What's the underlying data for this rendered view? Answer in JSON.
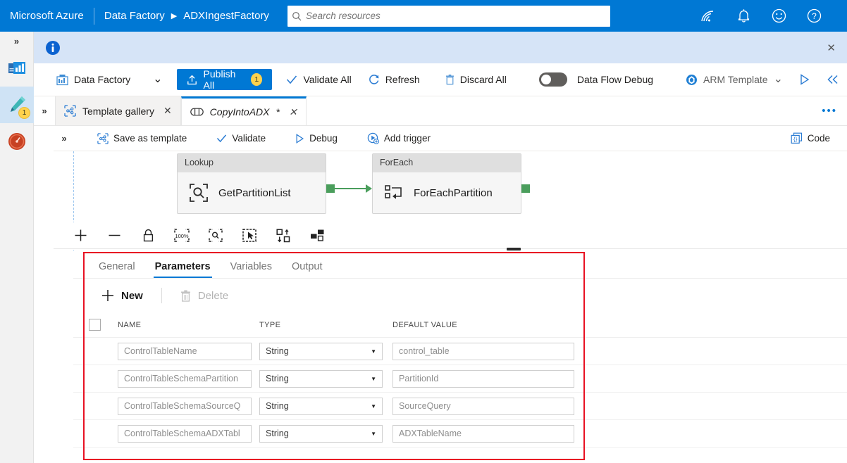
{
  "azure_bar": {
    "brand": "Microsoft Azure",
    "breadcrumb_service": "Data Factory",
    "breadcrumb_chevron": "▶",
    "breadcrumb_resource": "ADXIngestFactory",
    "search_placeholder": "Search resources",
    "search_value": "",
    "icons": [
      "cloud-shell-icon",
      "notifications-bell-icon",
      "feedback-smiley-icon",
      "help-question-icon"
    ],
    "accent_color": "#0078d4"
  },
  "rail": {
    "expand_glyph": "»",
    "items": [
      {
        "name": "home-monitor-icon",
        "badge": ""
      },
      {
        "name": "author-pencil-icon",
        "badge": "1"
      },
      {
        "name": "monitor-gauge-icon",
        "badge": ""
      }
    ]
  },
  "infobar": {
    "icon": "info-circle-icon",
    "message": "",
    "close_label": "✕",
    "background": "#d6e4f7"
  },
  "main_toolbar": {
    "factory_label": "Data Factory",
    "factory_caret": "⌄",
    "publish_label": "Publish All",
    "publish_badge": "1",
    "validate_all_label": "Validate All",
    "refresh_label": "Refresh",
    "discard_all_label": "Discard All",
    "data_flow_debug_label": "Data Flow Debug",
    "data_flow_debug_on": false,
    "arm_template_label": "ARM Template",
    "arm_caret": "⌄",
    "run_icon": "play-triangle-icon",
    "collapse_icon": "double-chevron-left-icon"
  },
  "tabstrip": {
    "expand_glyph": "»",
    "tabs": [
      {
        "label": "Template gallery",
        "icon": "template-gallery-icon",
        "active": false,
        "close": "✕",
        "dirty": ""
      },
      {
        "label": "CopyIntoADX",
        "icon": "pipeline-icon",
        "active": true,
        "close": "✕",
        "dirty": "*"
      }
    ],
    "overflow": "•••"
  },
  "pipeline_toolbar": {
    "expand_glyph": "»",
    "save_as_template_label": "Save as template",
    "validate_label": "Validate",
    "debug_label": "Debug",
    "add_trigger_label": "Add trigger",
    "code_label": "Code"
  },
  "canvas": {
    "activities": [
      {
        "type": "Lookup",
        "name": "GetPartitionList",
        "icon": "lookup-magnifier-icon"
      },
      {
        "type": "ForEach",
        "name": "ForEachPartition",
        "icon": "foreach-loop-icon"
      }
    ],
    "connector_color": "#4a9e5c"
  },
  "zoom_toolbar": {
    "icons": [
      "zoom-in-plus-icon",
      "zoom-out-minus-icon",
      "lock-canvas-icon",
      "zoom-to-100-percent-icon",
      "zoom-to-fit-icon",
      "select-region-icon",
      "auto-align-icon",
      "show-related-icon"
    ],
    "zoom_to_fit_label": "100%"
  },
  "properties_panel": {
    "tabs": [
      {
        "label": "General",
        "active": false
      },
      {
        "label": "Parameters",
        "active": true
      },
      {
        "label": "Variables",
        "active": false
      },
      {
        "label": "Output",
        "active": false
      }
    ],
    "commands": {
      "new_label": "New",
      "new_icon": "plus-icon",
      "delete_label": "Delete",
      "delete_icon": "trash-icon",
      "delete_disabled": true
    },
    "columns": [
      "NAME",
      "TYPE",
      "DEFAULT VALUE"
    ],
    "rows": [
      {
        "name": "ControlTableName",
        "type": "String",
        "default": "control_table"
      },
      {
        "name": "ControlTableSchemaPartition",
        "type": "String",
        "default": "PartitionId"
      },
      {
        "name": "ControlTableSchemaSourceQ",
        "type": "String",
        "default": "SourceQuery"
      },
      {
        "name": "ControlTableSchemaADXTabl",
        "type": "String",
        "default": "ADXTableName"
      }
    ],
    "type_caret": "▼",
    "highlight_color": "#e81123"
  }
}
